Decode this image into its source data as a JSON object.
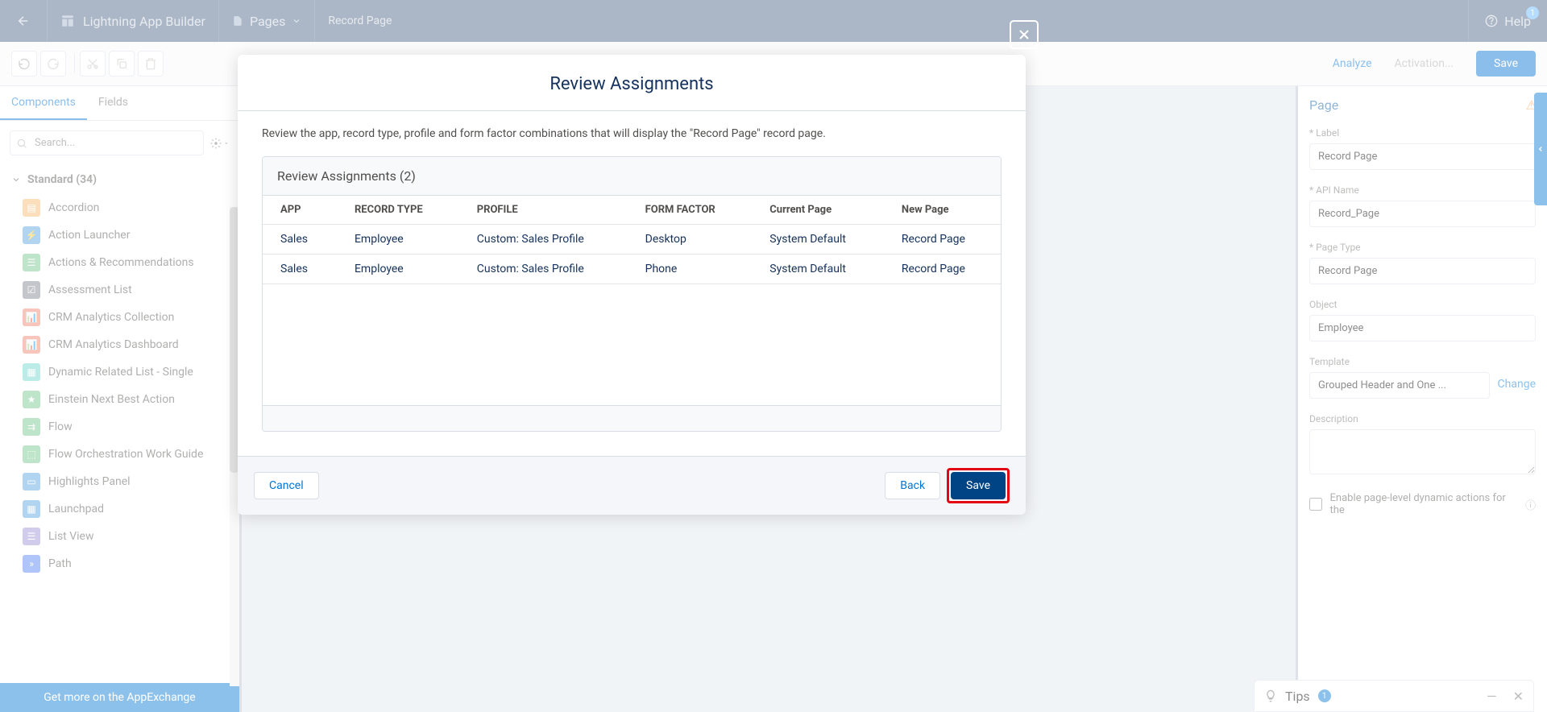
{
  "header": {
    "title": "Lightning App Builder",
    "pages_label": "Pages",
    "record_label": "Record Page",
    "help_label": "Help",
    "help_badge": "1"
  },
  "toolbar": {
    "analyze": "Analyze",
    "activation": "Activation...",
    "save": "Save"
  },
  "left": {
    "tabs": {
      "components": "Components",
      "fields": "Fields"
    },
    "search_placeholder": "Search...",
    "section_title": "Standard (34)",
    "items": [
      {
        "label": "Accordion",
        "color": "#f7b86c"
      },
      {
        "label": "Action Launcher",
        "color": "#53a1e0"
      },
      {
        "label": "Actions & Recommendations",
        "color": "#6fc38a"
      },
      {
        "label": "Assessment List",
        "color": "#7a828b"
      },
      {
        "label": "CRM Analytics Collection",
        "color": "#ef7f6b"
      },
      {
        "label": "CRM Analytics Dashboard",
        "color": "#ef7f6b"
      },
      {
        "label": "Dynamic Related List - Single",
        "color": "#6cd6c9"
      },
      {
        "label": "Einstein Next Best Action",
        "color": "#6fc38a"
      },
      {
        "label": "Flow",
        "color": "#6fc38a"
      },
      {
        "label": "Flow Orchestration Work Guide",
        "color": "#6fc38a"
      },
      {
        "label": "Highlights Panel",
        "color": "#53a1e0"
      },
      {
        "label": "Launchpad",
        "color": "#53a1e0"
      },
      {
        "label": "List View",
        "color": "#9a8ed6"
      },
      {
        "label": "Path",
        "color": "#4f7cf2"
      }
    ],
    "appexchange": "Get more on the AppExchange"
  },
  "right": {
    "page_heading": "Page",
    "label_label": "* Label",
    "label_value": "Record Page",
    "api_label": "* API Name",
    "api_value": "Record_Page",
    "pagetype_label": "* Page Type",
    "pagetype_value": "Record Page",
    "object_label": "Object",
    "object_value": "Employee",
    "template_label": "Template",
    "template_value": "Grouped Header and One ...",
    "change": "Change",
    "description_label": "Description",
    "dynamic_label": "Enable page-level dynamic actions for the"
  },
  "tips": {
    "label": "Tips",
    "count": "1"
  },
  "modal": {
    "title": "Review Assignments",
    "description": "Review the app, record type, profile and form factor combinations that will display the \"Record Page\" record page.",
    "section_title": "Review Assignments (2)",
    "columns": {
      "app": "APP",
      "record_type": "RECORD TYPE",
      "profile": "PROFILE",
      "form_factor": "FORM FACTOR",
      "current_page": "Current Page",
      "new_page": "New Page"
    },
    "rows": [
      {
        "app": "Sales",
        "record_type": "Employee",
        "profile": "Custom: Sales Profile",
        "form_factor": "Desktop",
        "current_page": "System Default",
        "new_page": "Record Page"
      },
      {
        "app": "Sales",
        "record_type": "Employee",
        "profile": "Custom: Sales Profile",
        "form_factor": "Phone",
        "current_page": "System Default",
        "new_page": "Record Page"
      }
    ],
    "cancel": "Cancel",
    "back": "Back",
    "save": "Save"
  }
}
